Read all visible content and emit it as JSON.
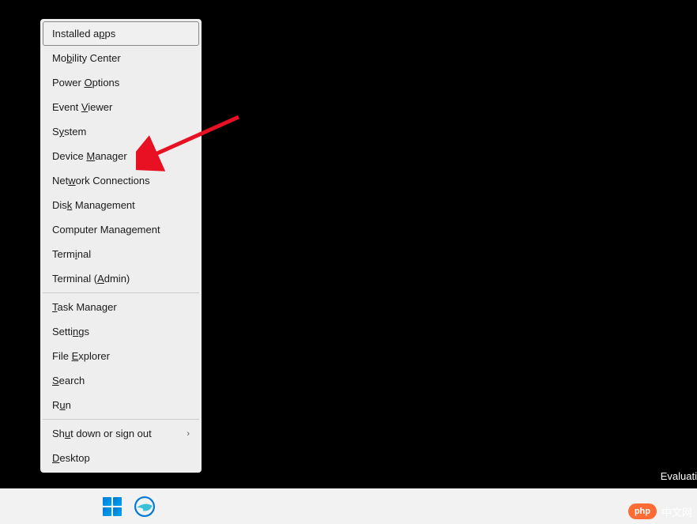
{
  "menu": {
    "groups": [
      [
        {
          "name": "installed-apps",
          "pre": "Installed a",
          "u": "p",
          "post": "ps",
          "highlighted": true
        },
        {
          "name": "mobility-center",
          "pre": "Mo",
          "u": "b",
          "post": "ility Center"
        },
        {
          "name": "power-options",
          "pre": "Power ",
          "u": "O",
          "post": "ptions"
        },
        {
          "name": "event-viewer",
          "pre": "Event ",
          "u": "V",
          "post": "iewer"
        },
        {
          "name": "system",
          "pre": "S",
          "u": "y",
          "post": "stem"
        },
        {
          "name": "device-manager",
          "pre": "Device ",
          "u": "M",
          "post": "anager"
        },
        {
          "name": "network-connections",
          "pre": "Net",
          "u": "w",
          "post": "ork Connections"
        },
        {
          "name": "disk-management",
          "pre": "Dis",
          "u": "k",
          "post": " Management"
        },
        {
          "name": "computer-management",
          "pre": "Computer Mana",
          "u": "g",
          "post": "ement"
        },
        {
          "name": "terminal",
          "pre": "Term",
          "u": "i",
          "post": "nal"
        },
        {
          "name": "terminal-admin",
          "pre": "Terminal (",
          "u": "A",
          "post": "dmin)"
        }
      ],
      [
        {
          "name": "task-manager",
          "pre": "",
          "u": "T",
          "post": "ask Manager"
        },
        {
          "name": "settings",
          "pre": "Setti",
          "u": "n",
          "post": "gs"
        },
        {
          "name": "file-explorer",
          "pre": "File ",
          "u": "E",
          "post": "xplorer"
        },
        {
          "name": "search",
          "pre": "",
          "u": "S",
          "post": "earch"
        },
        {
          "name": "run",
          "pre": "R",
          "u": "u",
          "post": "n"
        }
      ],
      [
        {
          "name": "shut-down",
          "pre": "Sh",
          "u": "u",
          "post": "t down or sign out",
          "submenu": true
        },
        {
          "name": "desktop",
          "pre": "",
          "u": "D",
          "post": "esktop"
        }
      ]
    ]
  },
  "annotation": {
    "arrow_target": "device-manager"
  },
  "desktop": {
    "evaluation_text": "Evaluati"
  },
  "taskbar": {
    "start": "Start",
    "edge": "Microsoft Edge"
  },
  "watermark": {
    "badge": "php",
    "text": "中文网"
  }
}
